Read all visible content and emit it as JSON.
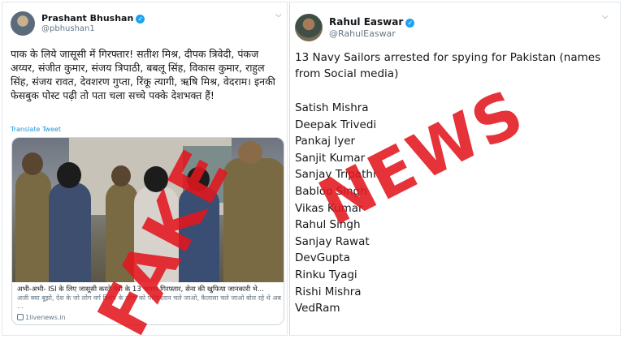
{
  "left_tweet": {
    "name": "Prashant Bhushan",
    "handle": "@pbhushan1",
    "text": "पाक के लिये जासूसी में गिरफ्तार! सतीश मिश्र, दीपक त्रिवेदी, पंकज अय्यर, संजीत कुमार, संजय त्रिपाठी, बबलू सिंह, विकास कुमार, राहुल सिंह, संजय रावत, देवशरण गुप्ता, रिंकू त्यागी, ऋषि मिश्र, वेदराम। इनकी फेसबुक पोस्ट पढ़ी तो पता चला सच्चे पक्के देशभक्त हैं!",
    "translate_label": "Translate Tweet",
    "card": {
      "title": "अभी-अभी- ISI के लिए जासूसी करते नेवी के 13 जवान गिरफ्तार, सेना की खुफिया जानकारी भे...",
      "description": "अजी क्या बूझो, देश के जो लोग वर्ग विशेष के लोगों को पाकिस्तान चले जाओ, कैलासा चले जाओ बोल रहे थे अब ...",
      "domain": "1livenews.in"
    }
  },
  "right_tweet": {
    "name": "Rahul Easwar",
    "handle": "@RahulEaswar",
    "text": "13 Navy Sailors arrested for spying for Pakistan (names from Social media)",
    "names": [
      "Satish Mishra",
      "Deepak Trivedi",
      "Pankaj Iyer",
      "Sanjit Kumar",
      "Sanjay Tripathi",
      "Babloo Singh",
      "Vikas Kumar",
      "Rahul Singh",
      "Sanjay Rawat",
      "DevGupta",
      "Rinku Tyagi",
      "Rishi Mishra",
      "VedRam"
    ]
  },
  "stamp": {
    "word1": "FAKE",
    "word2": "NEWS",
    "color": "#e2161e"
  },
  "icons": {
    "verified": "verified-badge-icon",
    "more": "chevron-down-icon",
    "link": "link-icon"
  }
}
